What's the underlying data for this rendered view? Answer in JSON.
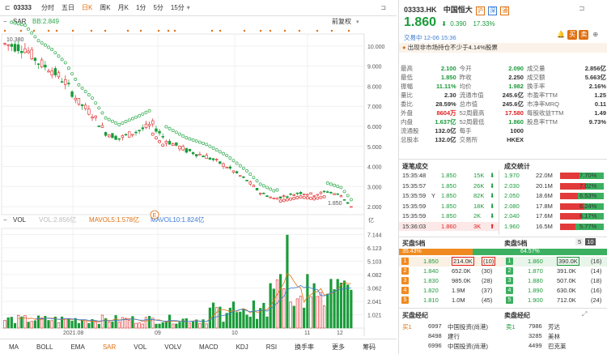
{
  "toolbar": {
    "code": "03333",
    "tabs": [
      "分时",
      "五日",
      "日K",
      "周K",
      "月K",
      "1分",
      "5分",
      "15分"
    ],
    "active_tab": "日K"
  },
  "indicator": {
    "name": "SAR",
    "bb": "BB:2.849",
    "adjust": "前复权",
    "price_high_label": "10.380",
    "price_low_label": "1.850"
  },
  "price_axis": [
    "10.000",
    "9.000",
    "8.000",
    "7.000",
    "6.000",
    "5.000",
    "4.000",
    "3.000",
    "2.000"
  ],
  "volume": {
    "name": "VOL",
    "vol": "VOL:2.856亿",
    "mavol5": "MAVOL5:1.578亿",
    "mavol10": "MAVOL10:1.824亿",
    "axis": [
      "7.144",
      "6.123",
      "5.103",
      "4.082",
      "3.062",
      "2.041",
      "1.021"
    ],
    "unit": "亿"
  },
  "date_axis": [
    "2021.08",
    "09",
    "10",
    "11",
    "12"
  ],
  "e_marker": "E",
  "bottom_tabs": [
    "MA",
    "BOLL",
    "EMA",
    "SAR",
    "VOL",
    "VOLV",
    "MACD",
    "KDJ",
    "RSI",
    "换手率",
    "更多",
    "筹码"
  ],
  "bottom_active": "SAR",
  "colors": {
    "up": "#e02020",
    "down": "#1a9b3a",
    "sar": "#2aa84a",
    "accent": "#e07010"
  },
  "header": {
    "code": "03333.HK",
    "name": "中国恒大",
    "tags": [
      "沪",
      "深",
      "通"
    ],
    "price": "1.860",
    "change": "0.390",
    "change_pct": "17.33%",
    "status": "交易中 12-06 15:36",
    "notice": "出现非市场持仓不少于4.14%股票"
  },
  "stats": [
    [
      "最高",
      "2.100",
      "今开",
      "2.090",
      "成交量",
      "2.856亿"
    ],
    [
      "最低",
      "1.850",
      "昨收",
      "2.250",
      "成交额",
      "5.663亿"
    ],
    [
      "振幅",
      "11.11%",
      "均价",
      "1.982",
      "换手率",
      "2.16%"
    ],
    [
      "量比",
      "2.30",
      "流通市值",
      "245.6亿",
      "市盈率TTM",
      "1.25"
    ],
    [
      "委比",
      "28.59%",
      "总市值",
      "245.6亿",
      "市净率MRQ",
      "0.11"
    ],
    [
      "外盘",
      "8604万",
      "52周最高",
      "17.580",
      "每股收益TTM",
      "1.49"
    ],
    [
      "内盘",
      "1.637亿",
      "52周最低",
      "1.860",
      "股息率TTM",
      "9.73%"
    ],
    [
      "流通股",
      "132.0亿",
      "每手",
      "1000",
      "",
      ""
    ],
    [
      "总股本",
      "132.0亿",
      "交易所",
      "HKEX",
      "",
      ""
    ]
  ],
  "trades_title": "逐笔成交",
  "stats_title": "成交统计",
  "trades": [
    {
      "time": "15:35:48",
      "flag": "",
      "price": "1.850",
      "vol": "15K"
    },
    {
      "time": "15:35:57",
      "flag": "",
      "price": "1.850",
      "vol": "26K"
    },
    {
      "time": "15:35:59",
      "flag": "Y",
      "price": "1.850",
      "vol": "82K"
    },
    {
      "time": "15:35:59",
      "flag": "",
      "price": "1.850",
      "vol": "18K"
    },
    {
      "time": "15:35:59",
      "flag": "",
      "price": "1.850",
      "vol": "2K"
    },
    {
      "time": "15:36:03",
      "flag": "",
      "price": "1.860",
      "vol": "3K"
    }
  ],
  "deal_stats": [
    {
      "price": "1.970",
      "vol": "22.0M",
      "pct": "7.70%",
      "buy": 0.45
    },
    {
      "price": "2.030",
      "vol": "20.1M",
      "pct": "7.02%",
      "buy": 0.6
    },
    {
      "price": "2.050",
      "vol": "18.6M",
      "pct": "6.53%",
      "buy": 0.4
    },
    {
      "price": "2.080",
      "vol": "17.8M",
      "pct": "6.24%",
      "buy": 0.55
    },
    {
      "price": "2.040",
      "vol": "17.6M",
      "pct": "6.17%",
      "buy": 0.5
    },
    {
      "price": "1.960",
      "vol": "16.5M",
      "pct": "5.77%",
      "buy": 0.35
    }
  ],
  "book": {
    "buy_title": "买盘5档",
    "sell_title": "卖盘5档",
    "buy_pct": "35.43%",
    "sell_pct": "64.57%",
    "buy_ratio": 0.3543,
    "level_opt": "5",
    "level_opt2": "10",
    "bids": [
      {
        "lvl": "1",
        "price": "1.850",
        "vol": "214.0K",
        "n": "(10)"
      },
      {
        "lvl": "2",
        "price": "1.840",
        "vol": "652.0K",
        "n": "(30)"
      },
      {
        "lvl": "3",
        "price": "1.830",
        "vol": "985.0K",
        "n": "(28)"
      },
      {
        "lvl": "4",
        "price": "1.820",
        "vol": "1.9M",
        "n": "(37)"
      },
      {
        "lvl": "5",
        "price": "1.810",
        "vol": "1.0M",
        "n": "(45)"
      }
    ],
    "asks": [
      {
        "lvl": "1",
        "price": "1.860",
        "vol": "390.0K",
        "n": "(16)"
      },
      {
        "lvl": "2",
        "price": "1.870",
        "vol": "391.0K",
        "n": "(14)"
      },
      {
        "lvl": "3",
        "price": "1.880",
        "vol": "507.0K",
        "n": "(18)"
      },
      {
        "lvl": "4",
        "price": "1.890",
        "vol": "630.0K",
        "n": "(16)"
      },
      {
        "lvl": "5",
        "price": "1.900",
        "vol": "712.0K",
        "n": "(24)"
      }
    ]
  },
  "brokers": {
    "buy_title": "买盘经纪",
    "sell_title": "卖盘经纪",
    "buy_label": "买1",
    "sell_label": "卖1",
    "buy": [
      {
        "id": "6997",
        "name": "中国投资(尚港)"
      },
      {
        "id": "8498",
        "name": "建行"
      },
      {
        "id": "6996",
        "name": "中国投资(尚港)"
      }
    ],
    "sell": [
      {
        "id": "7986",
        "name": "芳达"
      },
      {
        "id": "3285",
        "name": "美林"
      },
      {
        "id": "4499",
        "name": "巴克莱"
      }
    ]
  }
}
